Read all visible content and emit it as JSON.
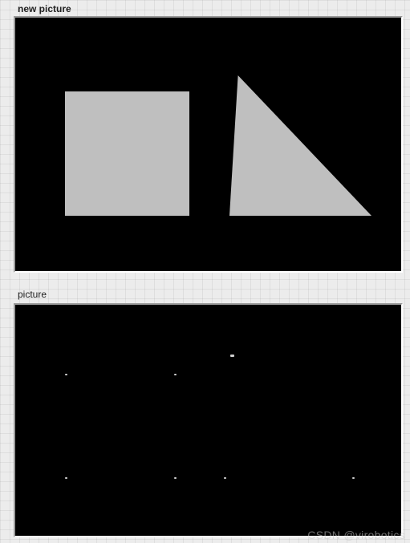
{
  "panels": {
    "top": {
      "label": "new picture"
    },
    "bottom": {
      "label": "picture"
    }
  },
  "shapes": {
    "square": {
      "color": "#bfbfbf"
    },
    "triangle": {
      "color": "#bfbfbf"
    }
  },
  "watermark": "CSDN @virobotics"
}
